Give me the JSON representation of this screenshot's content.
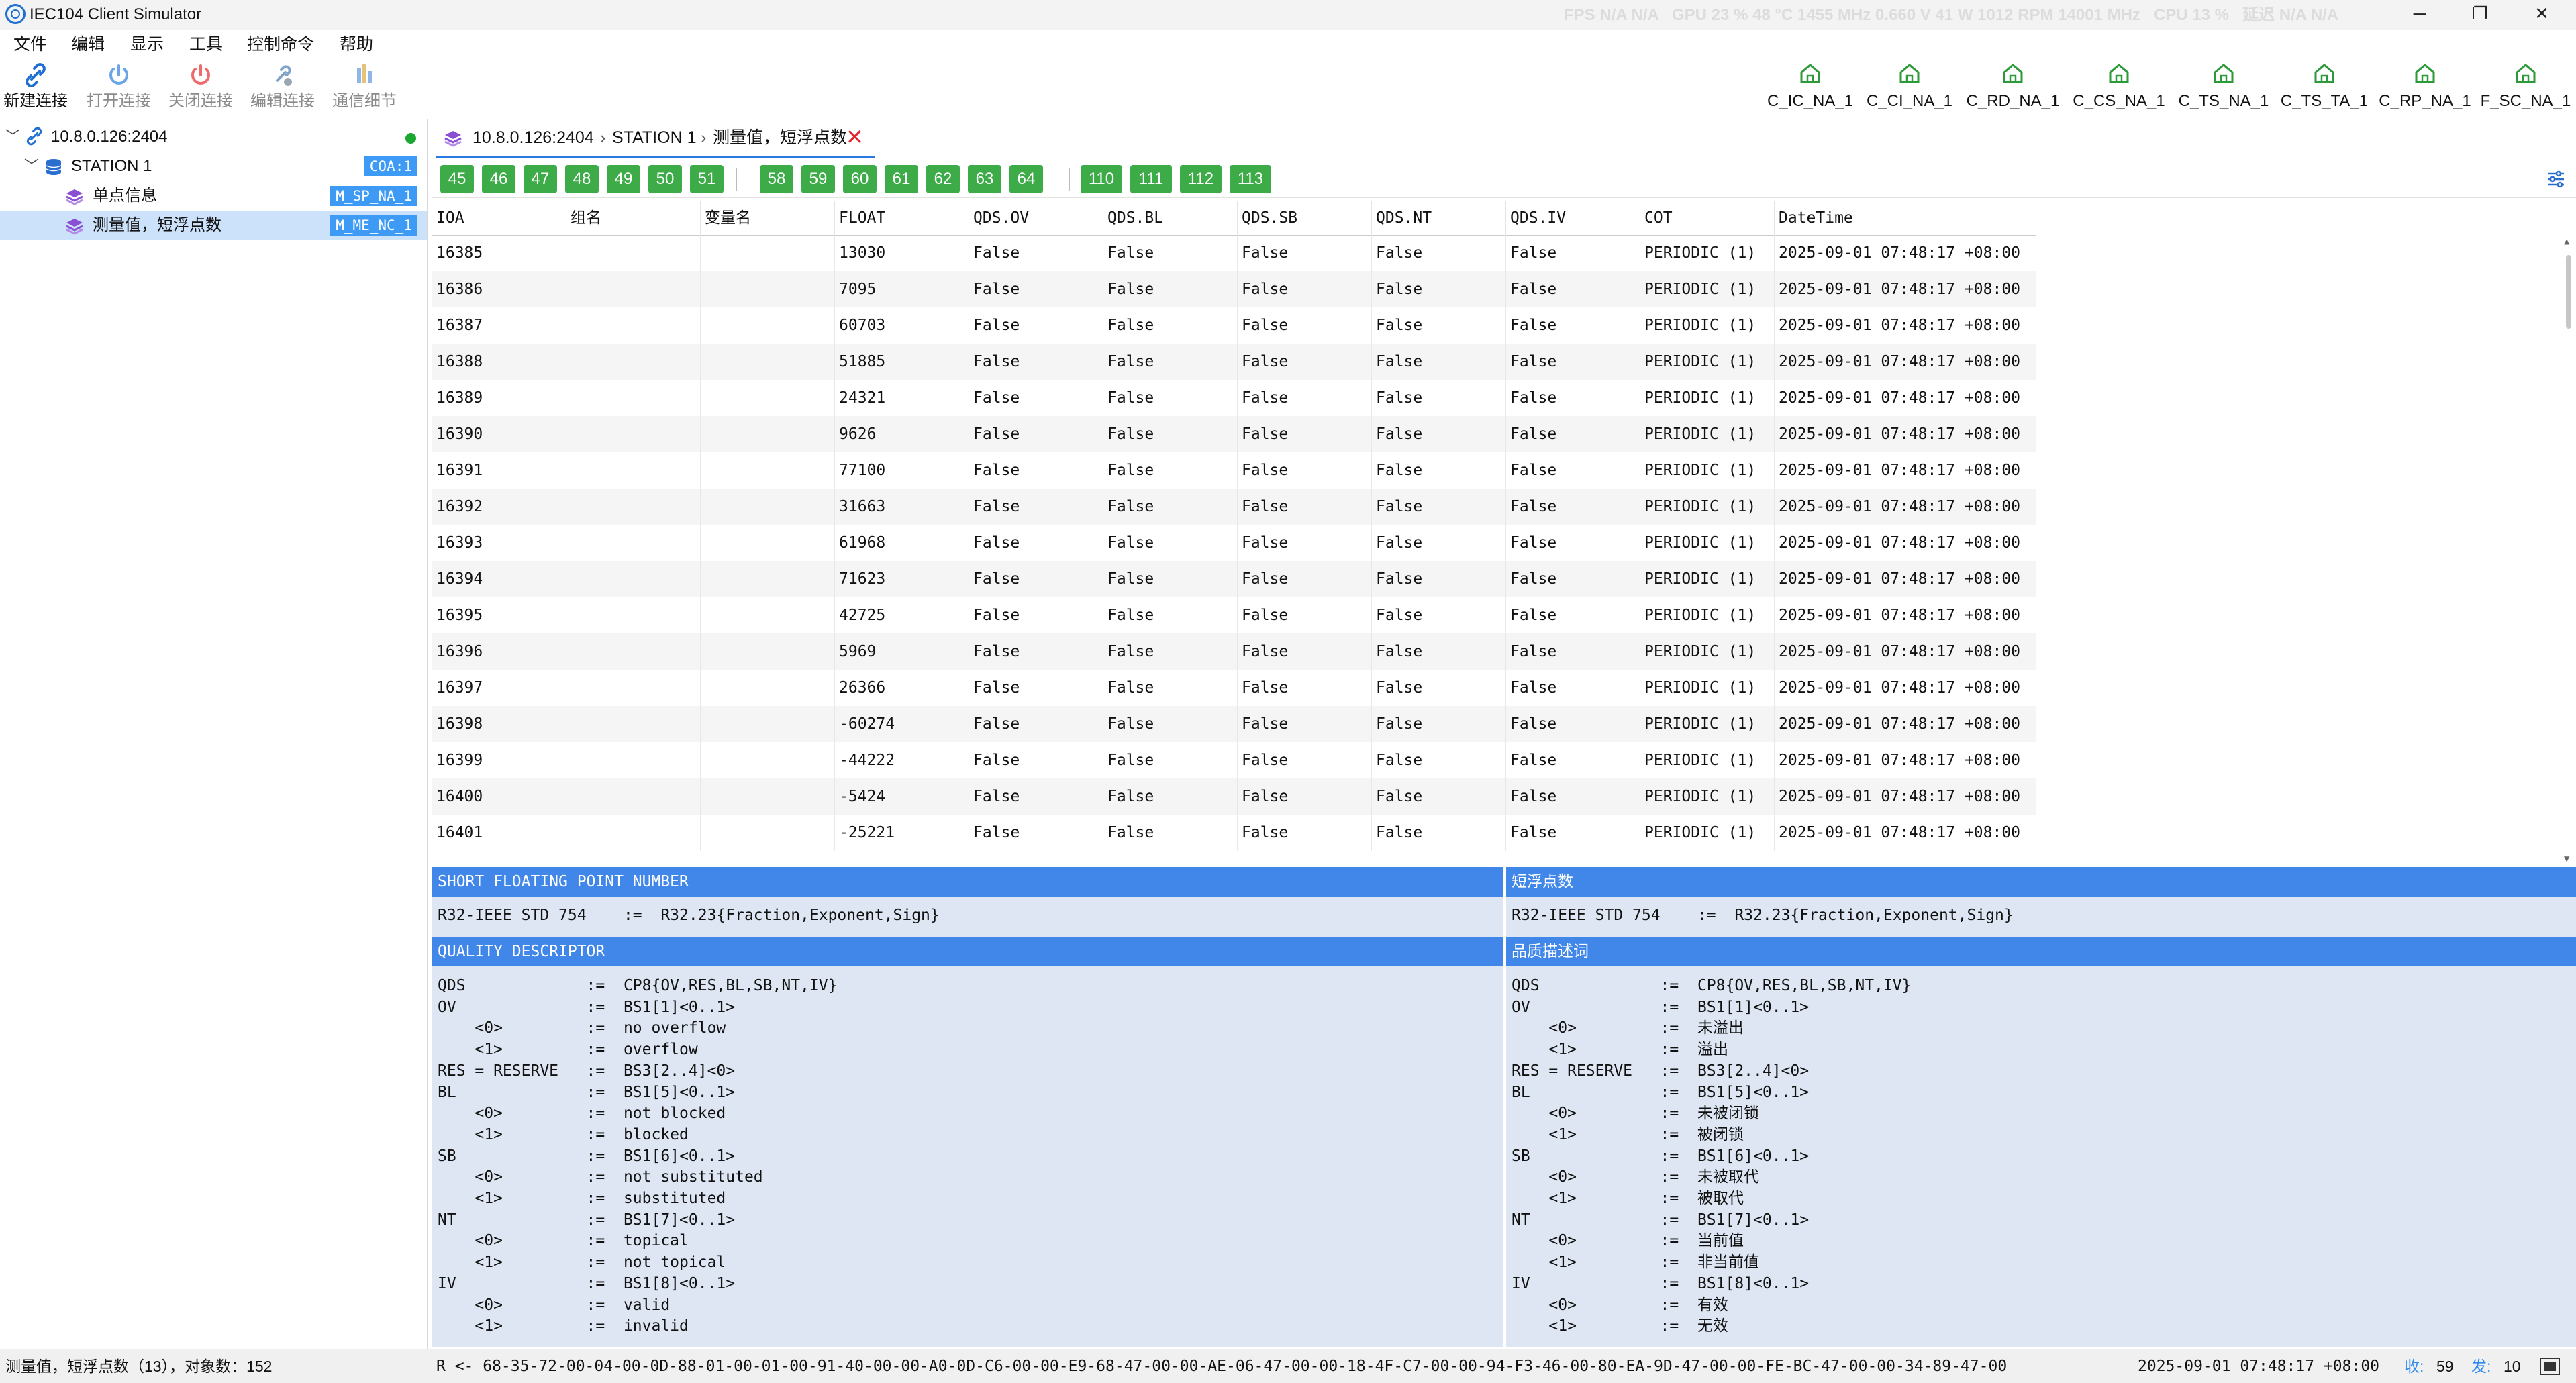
{
  "window": {
    "title": "IEC104 Client Simulator",
    "perf": [
      {
        "label": "FPS",
        "value": "N/A"
      },
      {
        "label": "N/A",
        "value": ""
      },
      {
        "label": "GPU",
        "value": "23 %"
      },
      {
        "label": "48 °C",
        "value": ""
      },
      {
        "label": "1455 MHz",
        "value": ""
      },
      {
        "label": "0.660 V",
        "value": ""
      },
      {
        "label": "41 W",
        "value": ""
      },
      {
        "label": "1012 RPM",
        "value": ""
      },
      {
        "label": "14001 MHz",
        "value": ""
      },
      {
        "label": "CPU",
        "value": "13 %"
      },
      {
        "label": "延迟",
        "value": "N/A"
      },
      {
        "label": "N/A",
        "value": ""
      }
    ],
    "controls": {
      "minimize": "─",
      "maximize": "❐",
      "close": "✕"
    }
  },
  "menu": [
    "文件",
    "编辑",
    "显示",
    "工具",
    "控制命令",
    "帮助"
  ],
  "toolbar": {
    "new_connection": "新建连接",
    "open_connection": "打开连接",
    "close_connection": "关闭连接",
    "edit_connection": "编辑连接",
    "comm_details": "通信细节"
  },
  "function_buttons": [
    "C_IC_NA_1",
    "C_CI_NA_1",
    "C_RD_NA_1",
    "C_CS_NA_1",
    "C_TS_NA_1",
    "C_TS_TA_1",
    "C_RP_NA_1",
    "F_SC_NA_1"
  ],
  "tree": {
    "connection": "10.8.0.126:2404",
    "station": "STATION 1",
    "station_tag": "COA:1",
    "items": [
      {
        "label": "单点信息",
        "tag": "M_SP_NA_1"
      },
      {
        "label": "测量值，短浮点数",
        "tag": "M_ME_NC_1"
      }
    ]
  },
  "breadcrumb": {
    "connection": "10.8.0.126:2404",
    "station": "STATION 1",
    "item": "测量值，短浮点数"
  },
  "pages": [
    [
      "45",
      "46",
      "47",
      "48",
      "49",
      "50",
      "51"
    ],
    [
      "58",
      "59",
      "60",
      "61",
      "62",
      "63",
      "64"
    ],
    [
      "110",
      "111",
      "112",
      "113"
    ]
  ],
  "table": {
    "columns": [
      "IOA",
      "组名",
      "变量名",
      "FLOAT",
      "QDS.OV",
      "QDS.BL",
      "QDS.SB",
      "QDS.NT",
      "QDS.IV",
      "COT",
      "DateTime"
    ],
    "rows": [
      [
        "16385",
        "",
        "",
        "13030",
        "False",
        "False",
        "False",
        "False",
        "False",
        "PERIODIC (1)",
        "2025-09-01 07:48:17 +08:00"
      ],
      [
        "16386",
        "",
        "",
        "7095",
        "False",
        "False",
        "False",
        "False",
        "False",
        "PERIODIC (1)",
        "2025-09-01 07:48:17 +08:00"
      ],
      [
        "16387",
        "",
        "",
        "60703",
        "False",
        "False",
        "False",
        "False",
        "False",
        "PERIODIC (1)",
        "2025-09-01 07:48:17 +08:00"
      ],
      [
        "16388",
        "",
        "",
        "51885",
        "False",
        "False",
        "False",
        "False",
        "False",
        "PERIODIC (1)",
        "2025-09-01 07:48:17 +08:00"
      ],
      [
        "16389",
        "",
        "",
        "24321",
        "False",
        "False",
        "False",
        "False",
        "False",
        "PERIODIC (1)",
        "2025-09-01 07:48:17 +08:00"
      ],
      [
        "16390",
        "",
        "",
        "9626",
        "False",
        "False",
        "False",
        "False",
        "False",
        "PERIODIC (1)",
        "2025-09-01 07:48:17 +08:00"
      ],
      [
        "16391",
        "",
        "",
        "77100",
        "False",
        "False",
        "False",
        "False",
        "False",
        "PERIODIC (1)",
        "2025-09-01 07:48:17 +08:00"
      ],
      [
        "16392",
        "",
        "",
        "31663",
        "False",
        "False",
        "False",
        "False",
        "False",
        "PERIODIC (1)",
        "2025-09-01 07:48:17 +08:00"
      ],
      [
        "16393",
        "",
        "",
        "61968",
        "False",
        "False",
        "False",
        "False",
        "False",
        "PERIODIC (1)",
        "2025-09-01 07:48:17 +08:00"
      ],
      [
        "16394",
        "",
        "",
        "71623",
        "False",
        "False",
        "False",
        "False",
        "False",
        "PERIODIC (1)",
        "2025-09-01 07:48:17 +08:00"
      ],
      [
        "16395",
        "",
        "",
        "42725",
        "False",
        "False",
        "False",
        "False",
        "False",
        "PERIODIC (1)",
        "2025-09-01 07:48:17 +08:00"
      ],
      [
        "16396",
        "",
        "",
        "5969",
        "False",
        "False",
        "False",
        "False",
        "False",
        "PERIODIC (1)",
        "2025-09-01 07:48:17 +08:00"
      ],
      [
        "16397",
        "",
        "",
        "26366",
        "False",
        "False",
        "False",
        "False",
        "False",
        "PERIODIC (1)",
        "2025-09-01 07:48:17 +08:00"
      ],
      [
        "16398",
        "",
        "",
        "-60274",
        "False",
        "False",
        "False",
        "False",
        "False",
        "PERIODIC (1)",
        "2025-09-01 07:48:17 +08:00"
      ],
      [
        "16399",
        "",
        "",
        "-44222",
        "False",
        "False",
        "False",
        "False",
        "False",
        "PERIODIC (1)",
        "2025-09-01 07:48:17 +08:00"
      ],
      [
        "16400",
        "",
        "",
        "-5424",
        "False",
        "False",
        "False",
        "False",
        "False",
        "PERIODIC (1)",
        "2025-09-01 07:48:17 +08:00"
      ],
      [
        "16401",
        "",
        "",
        "-25221",
        "False",
        "False",
        "False",
        "False",
        "False",
        "PERIODIC (1)",
        "2025-09-01 07:48:17 +08:00"
      ]
    ]
  },
  "desc_en": {
    "title1": "SHORT FLOATING POINT NUMBER",
    "line1": "R32-IEEE STD 754    :=  R32.23{Fraction,Exponent,Sign}",
    "title2": "QUALITY DESCRIPTOR",
    "block": "QDS             :=  CP8{OV,RES,BL,SB,NT,IV}\nOV              :=  BS1[1]<0..1>\n    <0>         :=  no overflow\n    <1>         :=  overflow\nRES = RESERVE   :=  BS3[2..4]<0>\nBL              :=  BS1[5]<0..1>\n    <0>         :=  not blocked\n    <1>         :=  blocked\nSB              :=  BS1[6]<0..1>\n    <0>         :=  not substituted\n    <1>         :=  substituted\nNT              :=  BS1[7]<0..1>\n    <0>         :=  topical\n    <1>         :=  not topical\nIV              :=  BS1[8]<0..1>\n    <0>         :=  valid\n    <1>         :=  invalid"
  },
  "desc_cn": {
    "title1": "短浮点数",
    "line1": "R32-IEEE STD 754    :=  R32.23{Fraction,Exponent,Sign}",
    "title2": "品质描述词",
    "block": "QDS             :=  CP8{OV,RES,BL,SB,NT,IV}\nOV              :=  BS1[1]<0..1>\n    <0>         :=  未溢出\n    <1>         :=  溢出\nRES = RESERVE   :=  BS3[2..4]<0>\nBL              :=  BS1[5]<0..1>\n    <0>         :=  未被闭锁\n    <1>         :=  被闭锁\nSB              :=  BS1[6]<0..1>\n    <0>         :=  未被取代\n    <1>         :=  被取代\nNT              :=  BS1[7]<0..1>\n    <0>         :=  当前值\n    <1>         :=  非当前值\nIV              :=  BS1[8]<0..1>\n    <0>         :=  有效\n    <1>         :=  无效"
  },
  "status": {
    "left": "测量值，短浮点数（13），对象数：152",
    "frame": "R <- 68-35-72-00-04-00-0D-88-01-00-01-00-91-40-00-00-A0-0D-C6-00-00-E9-68-47-00-00-AE-06-47-00-00-18-4F-C7-00-00-94-F3-46-00-80-EA-9D-47-00-00-FE-BC-47-00-00-34-89-47-00",
    "time": "2025-09-01 07:48:17 +08:00",
    "rx_label": "收:",
    "rx_value": "59",
    "tx_label": "发:",
    "tx_value": "10"
  },
  "colors": {
    "accent": "#4187ea",
    "page_button": "#3dab48",
    "tag": "#3d9bf5",
    "selection": "#cce2fa",
    "desc_bg": "#dde6f2",
    "close_red": "#e0252b",
    "online_green": "#1aa832"
  },
  "icons": {
    "new_connection": "link-icon",
    "open_connection": "power-icon",
    "close_connection": "power-off-icon",
    "edit_connection": "edit-link-icon",
    "comm_details": "bars-icon",
    "function": "house-icon",
    "filter": "sliders-icon"
  }
}
